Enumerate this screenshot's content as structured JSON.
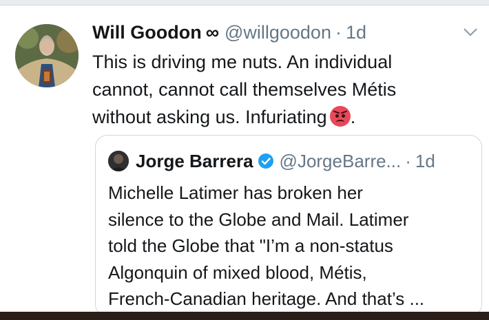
{
  "tweet": {
    "author": {
      "name": "Will Goodon",
      "badge": "∞",
      "handle": "@willgoodon",
      "time": "1d"
    },
    "separator": "·",
    "text_lines": [
      "This is driving me nuts. An individual",
      "cannot, cannot call themselves Métis",
      "without asking us. Infuriating"
    ],
    "text_end": ".",
    "emoji": "angry-face-emoji",
    "menu_icon": "chevron-down-icon"
  },
  "quoted_tweet": {
    "author": {
      "name": "Jorge Barrera",
      "handle": "@JorgeBarre...",
      "time": "1d",
      "verified_icon": "verified-badge-icon"
    },
    "separator": "·",
    "text_lines": [
      "Michelle Latimer has broken her",
      "silence to the Globe and Mail. Latimer",
      "told the Globe that \"I’m a non-status",
      "Algonquin of mixed blood, Métis,",
      "French-Canadian heritage. And that’s ..."
    ]
  },
  "colors": {
    "text": "#14171a",
    "secondary_text": "#657786",
    "border": "#ccd6dd",
    "verified": "#1da1f2",
    "emoji": "#e8485a",
    "bottom_bar": "#2b1e19"
  }
}
